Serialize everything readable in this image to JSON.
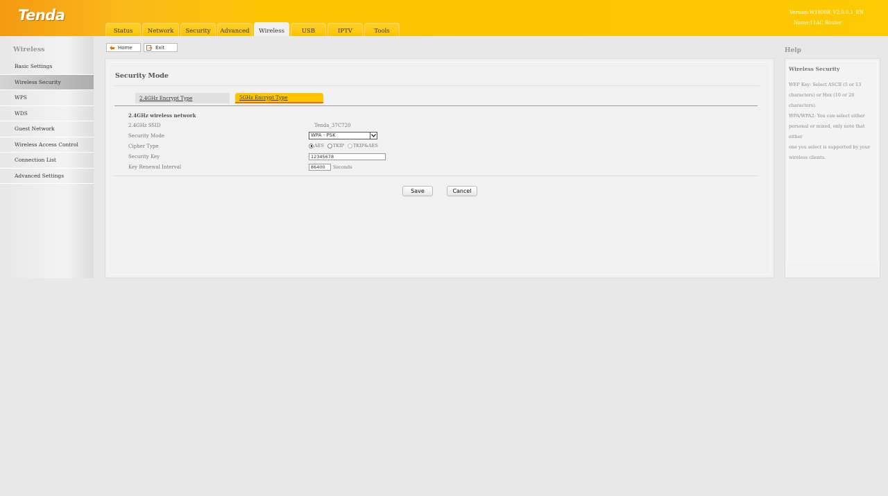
{
  "header": {
    "brand": "Tenda",
    "version": "Version:W1800R_V2.0.0.1_EN",
    "name": "Name:11AC Router",
    "tabs": [
      "Status",
      "Network",
      "Security",
      "Advanced",
      "Wireless",
      "USB",
      "IPTV",
      "Tools"
    ],
    "active_tab": "Wireless"
  },
  "sidebar": {
    "title": "Wireless",
    "items": [
      {
        "label": "Basic Settings",
        "active": false
      },
      {
        "label": "Wireless Security",
        "active": true
      },
      {
        "label": "WPS",
        "active": false
      },
      {
        "label": "WDS",
        "active": false
      },
      {
        "label": "Guest Network",
        "active": false
      },
      {
        "label": "Wireless Access Control",
        "active": false
      },
      {
        "label": "Connection List",
        "active": false
      },
      {
        "label": "Advanced Settings",
        "active": false
      }
    ]
  },
  "toolbar": {
    "home_label": "Home",
    "exit_label": "Exit"
  },
  "main": {
    "section_title": "Security Mode",
    "enc_tabs": {
      "ghz24": "2.4GHz Encrypt Type",
      "ghz5": "5GHz Encrypt Type",
      "active": "5GHz Encrypt Type"
    },
    "network_heading": "2.4GHz wireless network",
    "ssid_label": "2.4GHz SSID",
    "ssid_value": "Tenda_37C720",
    "security_mode_label": "Security Mode",
    "security_mode_value": "WPA - PSK",
    "cipher_label": "Cipher Type",
    "cipher_options": [
      "AES",
      "TKIP",
      "TKIP&AES"
    ],
    "cipher_selected": "AES",
    "key_label": "Security Key",
    "key_value": "12345678",
    "renewal_label": "Key Renewal Interval",
    "renewal_value": "86400",
    "renewal_unit": "Seconds",
    "save_label": "Save",
    "cancel_label": "Cancel"
  },
  "help": {
    "heading": "Help",
    "title": "Wireless Security",
    "lines": [
      "WEP Key: Select ASCII (5 or 13",
      "characters) or Hex (10 or 26 characters).",
      "WPA/WPA2: You can select either",
      "personal or mixed, only note that either",
      "one you select is supported by your",
      "wireless clients."
    ]
  },
  "colors": {
    "brand_yellow": "#fcc402",
    "brand_orange": "#f39a12",
    "accent_underline": "#e8730e"
  }
}
